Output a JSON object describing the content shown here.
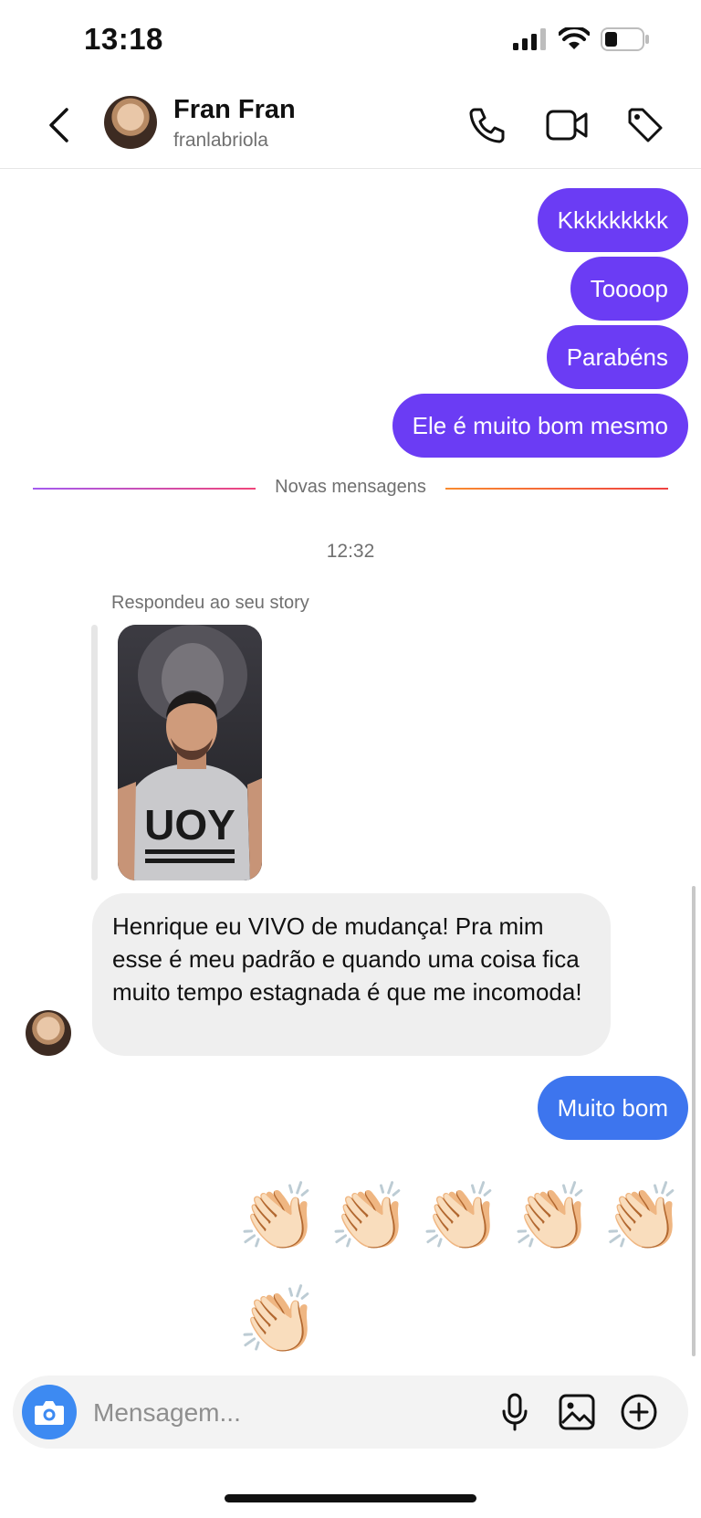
{
  "status_bar": {
    "time": "13:18",
    "battery_level_fraction": 0.35
  },
  "header": {
    "contact_name": "Fran Fran",
    "contact_username": "franlabriola",
    "icons": [
      "back-chevron-icon",
      "phone-icon",
      "video-call-icon",
      "tag-icon"
    ]
  },
  "messages_out_top": [
    {
      "text": "Kkkkkkkkk"
    },
    {
      "text": "Toooop"
    },
    {
      "text": "Parabéns"
    },
    {
      "text": "Ele é muito bom mesmo"
    }
  ],
  "divider": {
    "label": "Novas mensagens"
  },
  "timestamp": "12:32",
  "story_reply": {
    "label": "Respondeu ao seu story",
    "shirt_text": "UOY"
  },
  "incoming": {
    "text": "Henrique eu VIVO de mudança! Pra mim esse é meu padrão e quando uma coisa fica muito tempo estagnada é que me incomoda!"
  },
  "outgoing_reply": {
    "text": "Muito bom"
  },
  "emoji_reaction": {
    "glyph": "👏🏻",
    "count": 6
  },
  "composer": {
    "placeholder": "Mensagem...",
    "icons": [
      "camera-icon",
      "microphone-icon",
      "gallery-icon",
      "add-icon"
    ]
  },
  "colors": {
    "outgoing_bubble": "#6b3cf4",
    "outgoing_bubble_latest": "#3d75ee",
    "incoming_bubble": "#efefef",
    "camera_button": "#3d8af2"
  }
}
